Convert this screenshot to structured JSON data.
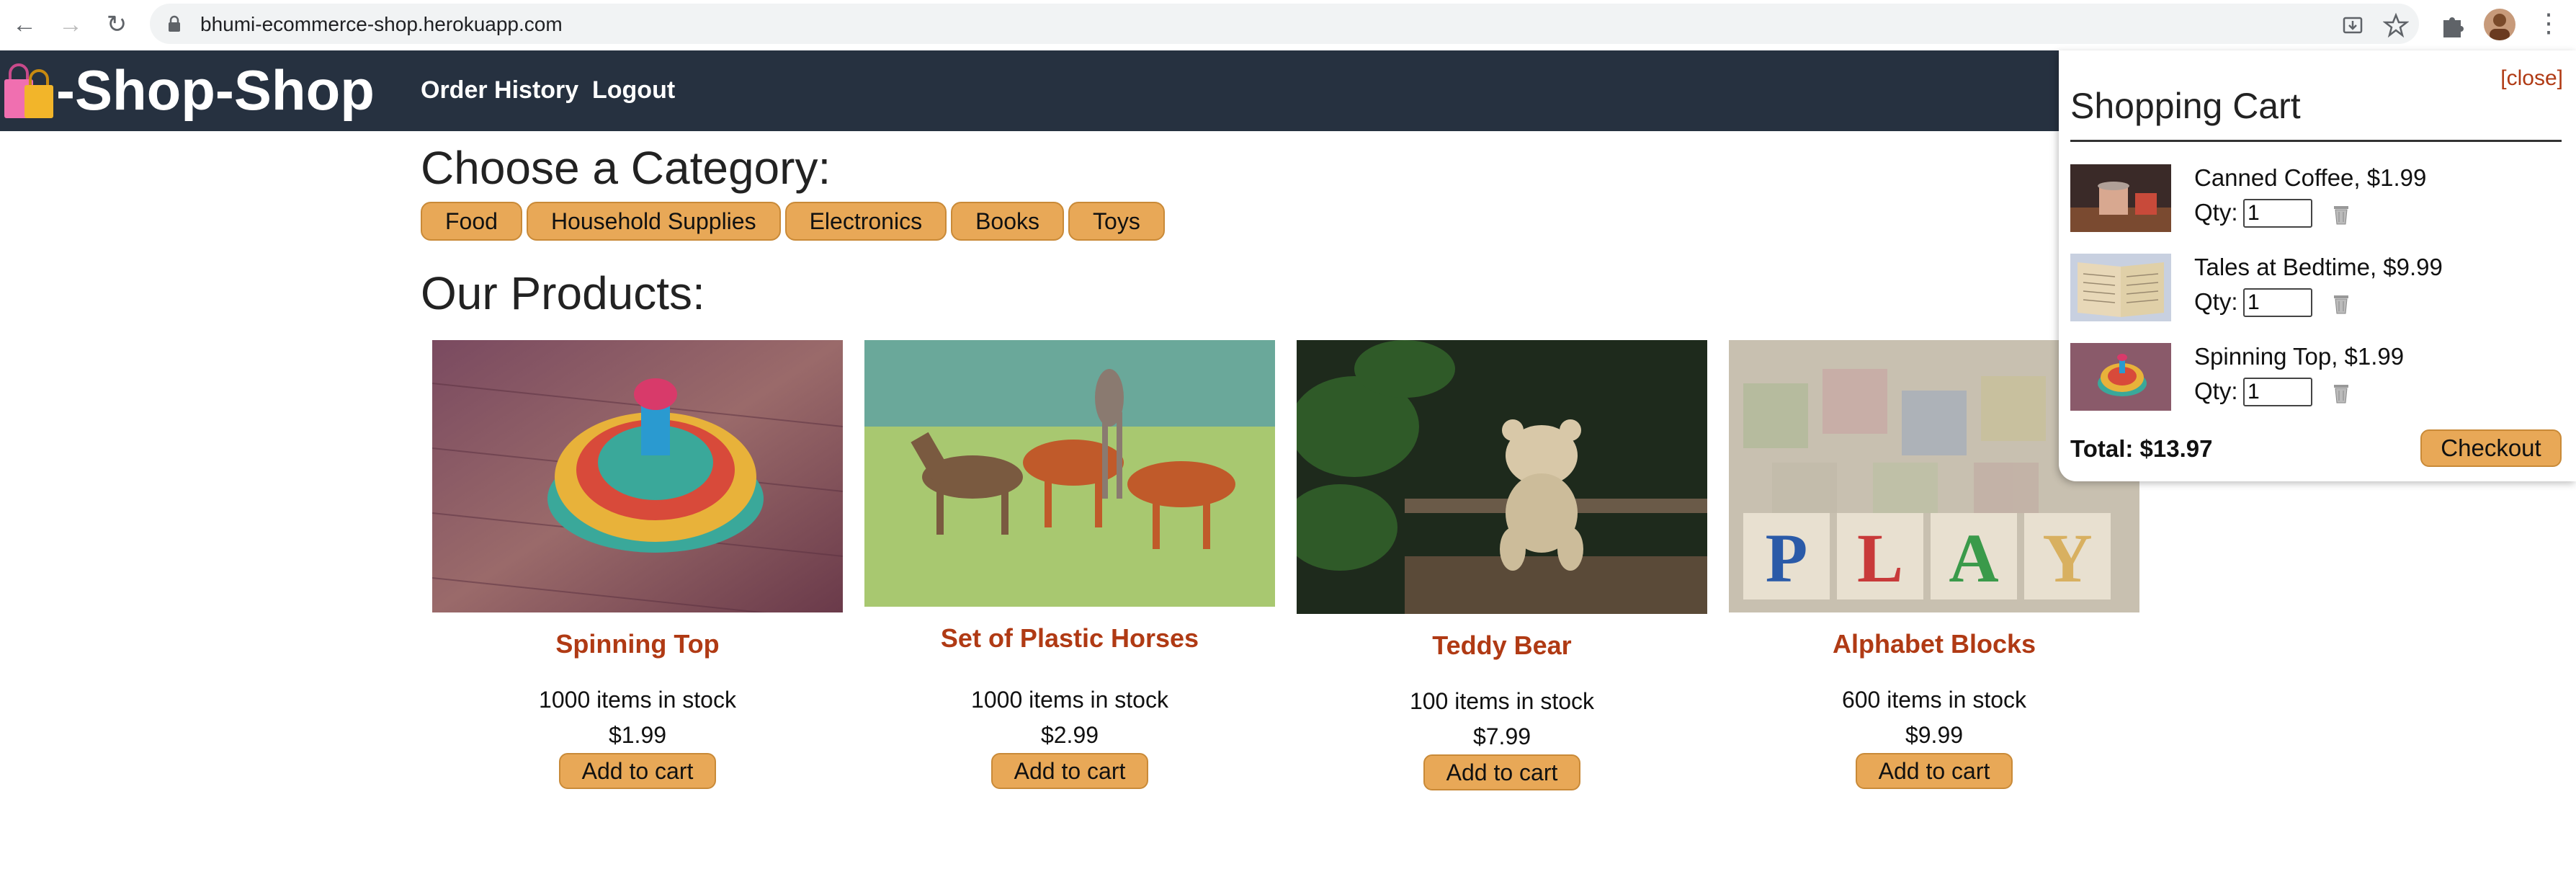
{
  "browser": {
    "url": "bhumi-ecommerce-shop.herokuapp.com",
    "back_icon": "←",
    "forward_icon": "→",
    "reload_icon": "↻",
    "menu_icon": "⋮"
  },
  "header": {
    "logo_text": "-Shop-Shop",
    "nav": [
      "Order History",
      "Logout"
    ]
  },
  "main": {
    "category_heading": "Choose a Category:",
    "categories": [
      "Food",
      "Household Supplies",
      "Electronics",
      "Books",
      "Toys"
    ],
    "products_heading": "Our Products:",
    "products": [
      {
        "name": "Spinning Top",
        "stock": "1000 items in stock",
        "price": "$1.99",
        "button": "Add to cart"
      },
      {
        "name": "Set of Plastic Horses",
        "stock": "1000 items in stock",
        "price": "$2.99",
        "button": "Add to cart"
      },
      {
        "name": "Teddy Bear",
        "stock": "100 items in stock",
        "price": "$7.99",
        "button": "Add to cart"
      },
      {
        "name": "Alphabet Blocks",
        "stock": "600 items in stock",
        "price": "$9.99",
        "button": "Add to cart"
      }
    ]
  },
  "cart": {
    "close": "[close]",
    "title": "Shopping Cart",
    "qty_label": "Qty:",
    "items": [
      {
        "name": "Canned Coffee, $1.99",
        "qty": "1"
      },
      {
        "name": "Tales at Bedtime, $9.99",
        "qty": "1"
      },
      {
        "name": "Spinning Top, $1.99",
        "qty": "1"
      }
    ],
    "total": "Total: $13.97",
    "checkout": "Checkout"
  },
  "colors": {
    "header_bg": "#263140",
    "button_orange": "#e8a857",
    "product_name": "#b03a14"
  }
}
